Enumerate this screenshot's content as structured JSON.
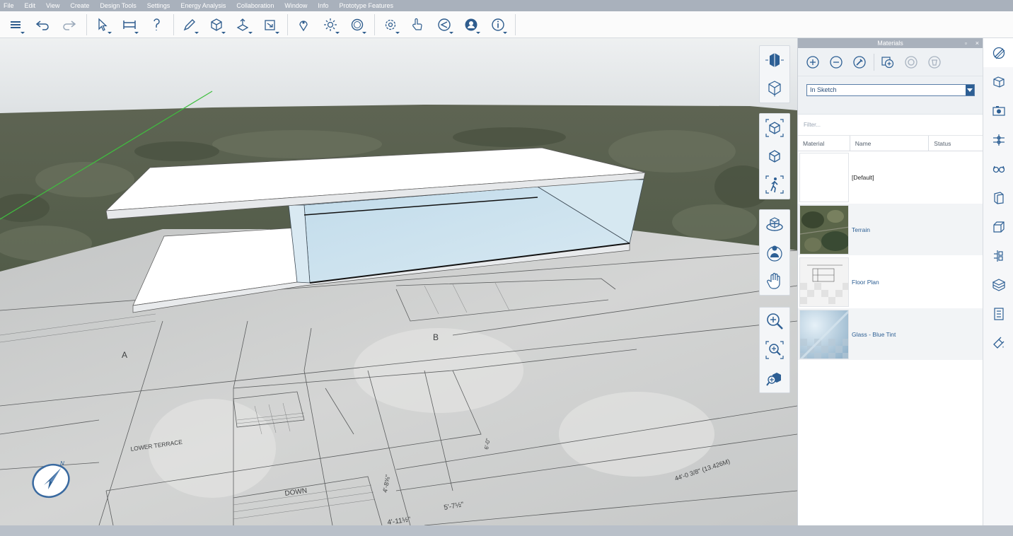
{
  "menu": [
    "File",
    "Edit",
    "View",
    "Create",
    "Design Tools",
    "Settings",
    "Energy Analysis",
    "Collaboration",
    "Window",
    "Info",
    "Prototype Features"
  ],
  "toolbar": {
    "groups": [
      [
        "layers-icon",
        "undo-icon",
        "redo-icon"
      ],
      [
        "select-icon",
        "dimension-icon",
        "tape-measure-icon"
      ],
      [
        "draw-icon",
        "solid-tools-icon",
        "push-pull-icon",
        "move-icon"
      ],
      [
        "location-icon",
        "sun-icon",
        "styles-icon"
      ],
      [
        "settings-icon",
        "interaction-icon",
        "presentation-icon",
        "account-icon",
        "info-icon"
      ]
    ]
  },
  "viewport": {
    "plan_labels": {
      "lower_terrace": "LOWER TERRACE",
      "down": "DOWN",
      "dim_1": "44'-0 3/8\" (13.426M)",
      "dim_2": "5'-7½\"",
      "dim_3": "4'-8⅝\"",
      "dim_4": "4'-11½\"",
      "section_a": "A",
      "section_b": "B",
      "dim_5": "6'-0\""
    },
    "nav_groups": [
      [
        "view-cube-icon",
        "wireframe-cube-icon"
      ],
      [
        "fit-view-icon",
        "perspective-view-icon",
        "walk-icon"
      ],
      [
        "orbit-icon",
        "look-around-icon",
        "pan-hand-icon"
      ],
      [
        "zoom-icon",
        "zoom-window-icon",
        "zoom-extents-icon"
      ]
    ]
  },
  "materials_panel": {
    "title": "Materials",
    "title_buttons": {
      "float": "▫",
      "close": "×"
    },
    "tools": [
      "add-material-icon",
      "remove-material-icon",
      "eyedropper-icon",
      "add-from-library-icon",
      "replace-material-icon",
      "purge-materials-icon"
    ],
    "scope": "In Sketch",
    "filter_placeholder": "Filter...",
    "columns": [
      "Material",
      "Name",
      "Status"
    ],
    "materials": [
      {
        "name": "[Default]"
      },
      {
        "name": "Terrain"
      },
      {
        "name": "Floor Plan"
      },
      {
        "name": "Glass - Blue Tint"
      }
    ]
  },
  "rail": [
    "materials-icon",
    "geometry-icon",
    "scenes-icon",
    "layers-panel-icon",
    "glasses-icon",
    "surface-icon",
    "massing-icon",
    "components-icon",
    "library-icon",
    "properties-icon",
    "paint-icon"
  ],
  "colors": {
    "accent": "#2c5e93",
    "glass": "#cfe3ef",
    "menubar": "#a9b1bc"
  }
}
